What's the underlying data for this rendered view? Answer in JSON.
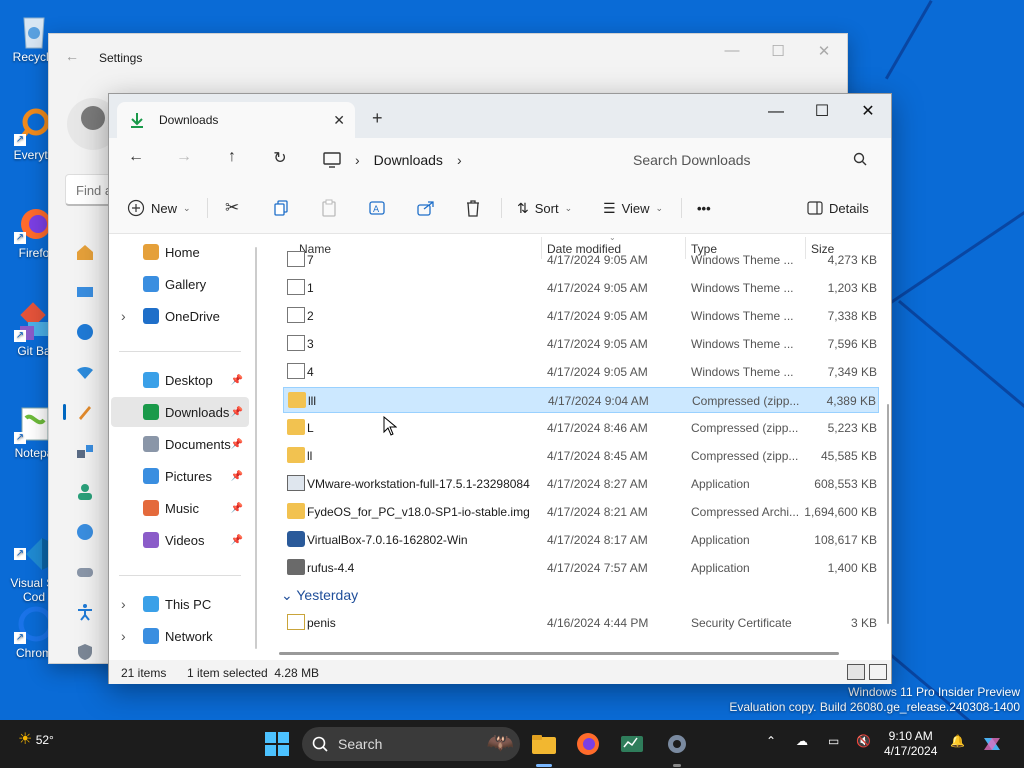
{
  "desktop": {
    "icons": [
      {
        "label": "Recycle",
        "icon": "recycle-bin-icon"
      },
      {
        "label": "Everyth",
        "icon": "everything-search-icon"
      },
      {
        "label": "Firefo",
        "icon": "firefox-icon"
      },
      {
        "label": "Git Ba",
        "icon": "git-bash-icon"
      },
      {
        "label": "Notepa",
        "icon": "notepad-plus-plus-icon"
      },
      {
        "label": "Visual St\nCod",
        "icon": "visual-studio-code-icon"
      },
      {
        "label": "Chrom",
        "icon": "chrome-icon"
      }
    ],
    "watermark_line1": "Windows 11 Pro Insider Preview",
    "watermark_line2": "Evaluation copy. Build 26080.ge_release.240308-1400"
  },
  "settings": {
    "title": "Settings",
    "find_placeholder": "Find a"
  },
  "explorer": {
    "tab_title": "Downloads",
    "new_tab": "+",
    "address_segments": [
      "Downloads"
    ],
    "search_placeholder": "Search Downloads",
    "commands": {
      "new": "New",
      "sort": "Sort",
      "view": "View",
      "more": "•••",
      "details": "Details"
    },
    "nav": [
      {
        "label": "Home",
        "icon": "home-icon",
        "pinned": false,
        "expandable": false
      },
      {
        "label": "Gallery",
        "icon": "gallery-icon",
        "pinned": false,
        "expandable": false
      },
      {
        "label": "OneDrive",
        "icon": "onedrive-icon",
        "pinned": false,
        "expandable": true
      },
      {
        "label": "Desktop",
        "icon": "desktop-folder-icon",
        "pinned": true,
        "expandable": false
      },
      {
        "label": "Downloads",
        "icon": "downloads-folder-icon",
        "pinned": true,
        "expandable": false,
        "selected": true
      },
      {
        "label": "Documents",
        "icon": "documents-folder-icon",
        "pinned": true,
        "expandable": false
      },
      {
        "label": "Pictures",
        "icon": "pictures-folder-icon",
        "pinned": true,
        "expandable": false
      },
      {
        "label": "Music",
        "icon": "music-folder-icon",
        "pinned": true,
        "expandable": false
      },
      {
        "label": "Videos",
        "icon": "videos-folder-icon",
        "pinned": true,
        "expandable": false
      },
      {
        "label": "This PC",
        "icon": "this-pc-icon",
        "pinned": false,
        "expandable": true
      },
      {
        "label": "Network",
        "icon": "network-icon",
        "pinned": false,
        "expandable": true
      }
    ],
    "columns": {
      "name": "Name",
      "date": "Date modified",
      "type": "Type",
      "size": "Size"
    },
    "files_today": [
      {
        "name": "7",
        "date": "4/17/2024 9:05 AM",
        "type": "Windows Theme ...",
        "size": "4,273 KB",
        "icon": "theme-file-icon"
      },
      {
        "name": "1",
        "date": "4/17/2024 9:05 AM",
        "type": "Windows Theme ...",
        "size": "1,203 KB",
        "icon": "theme-file-icon"
      },
      {
        "name": "2",
        "date": "4/17/2024 9:05 AM",
        "type": "Windows Theme ...",
        "size": "7,338 KB",
        "icon": "theme-file-icon"
      },
      {
        "name": "3",
        "date": "4/17/2024 9:05 AM",
        "type": "Windows Theme ...",
        "size": "7,596 KB",
        "icon": "theme-file-icon"
      },
      {
        "name": "4",
        "date": "4/17/2024 9:05 AM",
        "type": "Windows Theme ...",
        "size": "7,349 KB",
        "icon": "theme-file-icon"
      },
      {
        "name": "lll",
        "date": "4/17/2024 9:04 AM",
        "type": "Compressed (zipp...",
        "size": "4,389 KB",
        "icon": "zip-folder-icon",
        "selected": true
      },
      {
        "name": "L",
        "date": "4/17/2024 8:46 AM",
        "type": "Compressed (zipp...",
        "size": "5,223 KB",
        "icon": "zip-folder-icon"
      },
      {
        "name": "ll",
        "date": "4/17/2024 8:45 AM",
        "type": "Compressed (zipp...",
        "size": "45,585 KB",
        "icon": "zip-folder-icon"
      },
      {
        "name": "VMware-workstation-full-17.5.1-23298084",
        "date": "4/17/2024 8:27 AM",
        "type": "Application",
        "size": "608,553 KB",
        "icon": "installer-icon"
      },
      {
        "name": "FydeOS_for_PC_v18.0-SP1-io-stable.img",
        "date": "4/17/2024 8:21 AM",
        "type": "Compressed Archi...",
        "size": "1,694,600 KB",
        "icon": "zip-folder-icon"
      },
      {
        "name": "VirtualBox-7.0.16-162802-Win",
        "date": "4/17/2024 8:17 AM",
        "type": "Application",
        "size": "108,617 KB",
        "icon": "virtualbox-icon"
      },
      {
        "name": "rufus-4.4",
        "date": "4/17/2024 7:57 AM",
        "type": "Application",
        "size": "1,400 KB",
        "icon": "rufus-icon"
      }
    ],
    "group_yesterday": "Yesterday",
    "files_yesterday": [
      {
        "name": "penis",
        "date": "4/16/2024 4:44 PM",
        "type": "Security Certificate",
        "size": "3 KB",
        "icon": "certificate-icon"
      }
    ],
    "status": {
      "items": "21 items",
      "selection": "1 item selected  4.28 MB"
    }
  },
  "taskbar": {
    "weather_temp": "52°",
    "search_label": "Search",
    "time": "9:10 AM",
    "date": "4/17/2024"
  }
}
